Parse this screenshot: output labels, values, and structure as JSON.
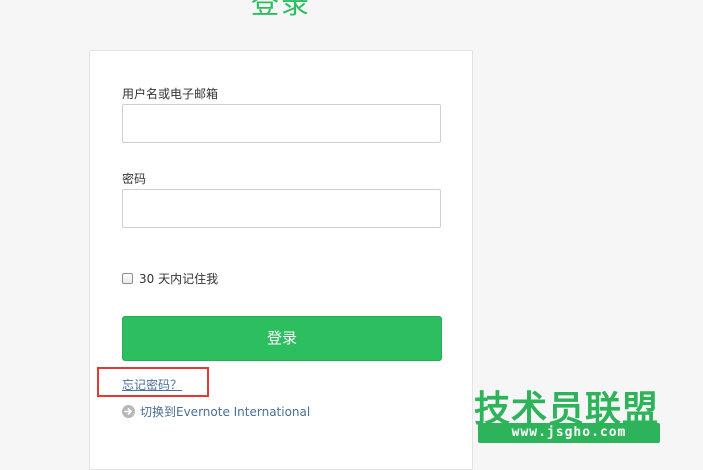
{
  "page": {
    "title": "登录"
  },
  "form": {
    "username_label": "用户名或电子邮箱",
    "username_value": "",
    "password_label": "密码",
    "password_value": "",
    "remember_label": "30 天内记住我",
    "remember_checked": false,
    "submit_label": "登录",
    "forgot_link": "忘记密码？",
    "switch_link": "切换到Evernote International"
  },
  "watermark": {
    "title": "技术员联盟",
    "url": "www.jsgho.com"
  },
  "colors": {
    "brand_green": "#2dbe60",
    "link_blue": "#4a6f99",
    "highlight_red": "#e53935"
  },
  "icons": {
    "switch": "arrow-right-circle-icon"
  }
}
